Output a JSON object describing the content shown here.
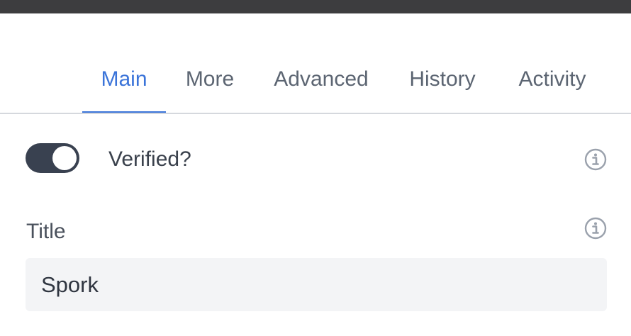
{
  "tabs": [
    {
      "label": "Main",
      "active": true
    },
    {
      "label": "More",
      "active": false
    },
    {
      "label": "Advanced",
      "active": false
    },
    {
      "label": "History",
      "active": false
    },
    {
      "label": "Activity",
      "active": false
    }
  ],
  "verified": {
    "label": "Verified?",
    "checked": true,
    "info_icon": "info-icon"
  },
  "title_field": {
    "label": "Title",
    "value": "Spork",
    "info_icon": "info-icon"
  },
  "colors": {
    "accent": "#3b74d9",
    "toggle_on": "#394150",
    "topbar": "#3d3d3f",
    "input_bg": "#f3f4f6"
  }
}
